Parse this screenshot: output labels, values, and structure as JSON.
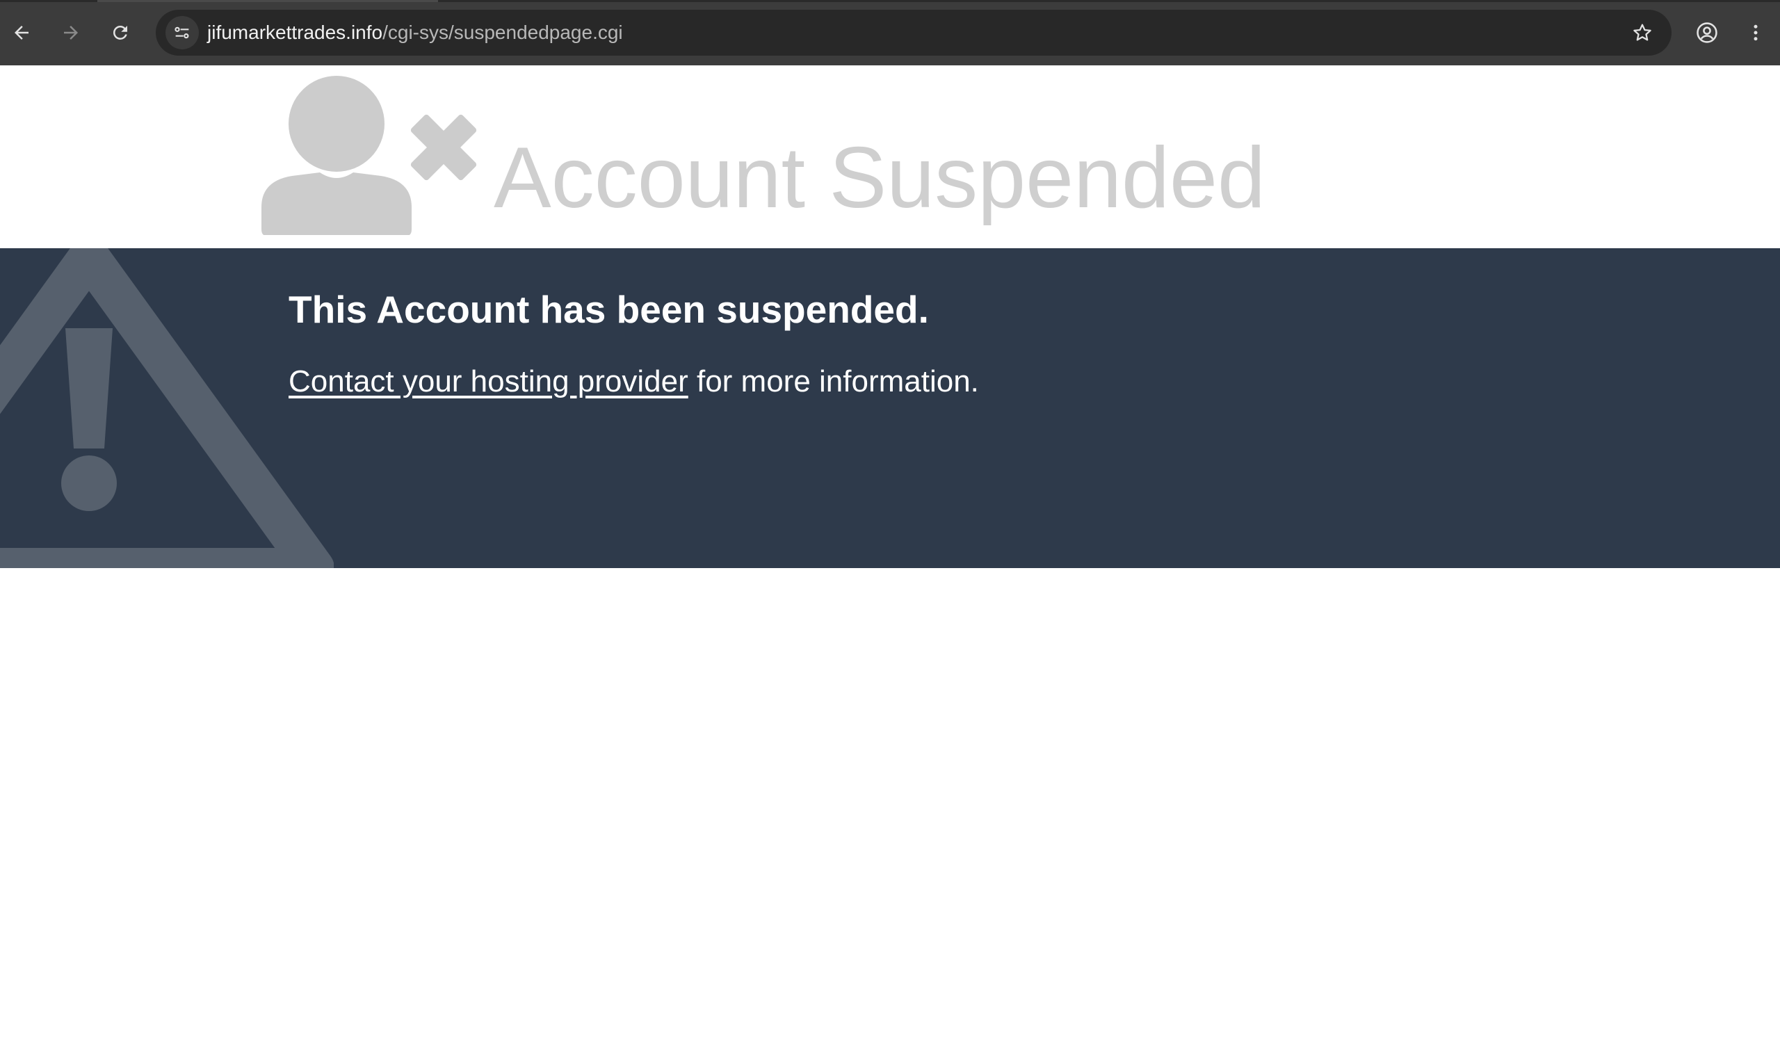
{
  "browser": {
    "url_host": "jifumarkettrades.info",
    "url_path": "/cgi-sys/suspendedpage.cgi",
    "icons": {
      "back": "back-arrow-icon",
      "forward": "forward-arrow-icon",
      "reload": "reload-icon",
      "site_info": "site-settings-icon",
      "bookmark": "star-icon",
      "profile": "profile-icon",
      "menu": "kebab-menu-icon"
    }
  },
  "header": {
    "title": "Account Suspended",
    "graphic_icon": "user-suspended-icon"
  },
  "notice": {
    "heading": "This Account has been suspended.",
    "link_text": "Contact your hosting provider",
    "trailing_text": " for more information.",
    "background_icon": "warning-triangle-icon"
  },
  "colors": {
    "chrome_bg": "#3c3c3c",
    "omnibox_bg": "#282828",
    "band_bg": "#2e3a4b",
    "header_gray": "#cfcfcf",
    "warning_gray": "#56606d"
  }
}
